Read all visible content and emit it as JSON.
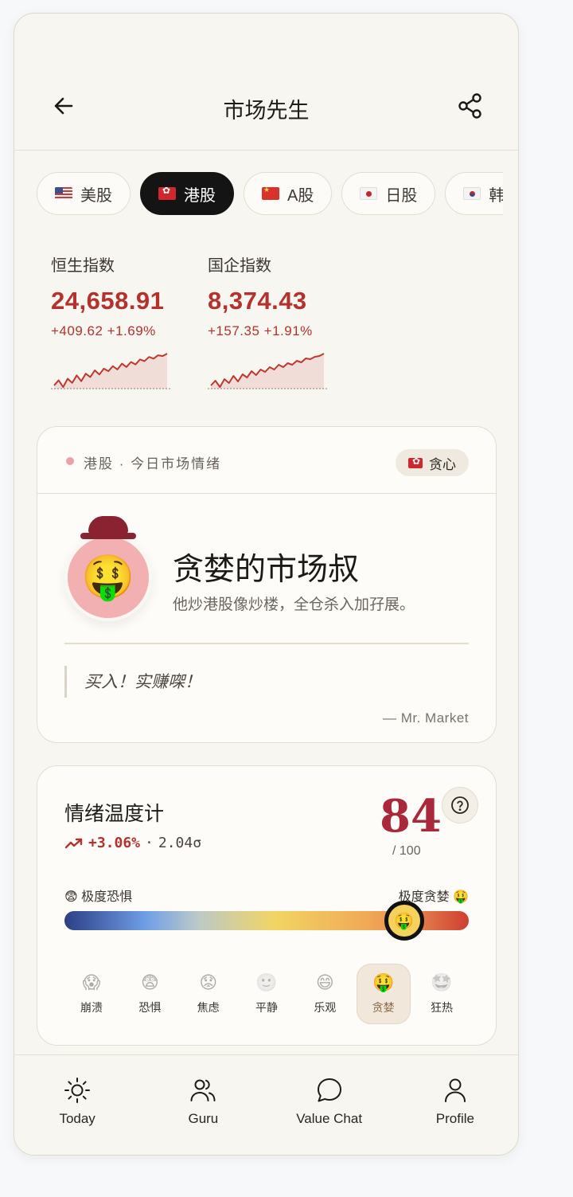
{
  "header": {
    "title": "市场先生",
    "back_icon": "arrow-left-icon",
    "share_icon": "share-icon"
  },
  "market_tabs": [
    {
      "label": "美股",
      "flag": "us-flag-icon",
      "active": false
    },
    {
      "label": "港股",
      "flag": "hk-flag-icon",
      "active": true
    },
    {
      "label": "A股",
      "flag": "cn-flag-icon",
      "active": false
    },
    {
      "label": "日股",
      "flag": "jp-flag-icon",
      "active": false
    },
    {
      "label": "韩",
      "flag": "kr-flag-icon",
      "active": false
    }
  ],
  "indices": [
    {
      "name": "恒生指数",
      "value": "24,658.91",
      "change": "+409.62 +1.69%",
      "trend": [
        8,
        14,
        6,
        16,
        11,
        20,
        13,
        22,
        18,
        26,
        21,
        28,
        25,
        31,
        27,
        34,
        30,
        36,
        33,
        39,
        37,
        42,
        40,
        44,
        43,
        46
      ]
    },
    {
      "name": "国企指数",
      "value": "8,374.43",
      "change": "+157.35 +1.91%",
      "trend": [
        7,
        13,
        5,
        15,
        10,
        19,
        12,
        21,
        17,
        25,
        20,
        27,
        24,
        30,
        27,
        33,
        30,
        35,
        33,
        38,
        36,
        41,
        40,
        43,
        44,
        47
      ]
    }
  ],
  "mood_card": {
    "label": "港股 · 今日市场情绪",
    "badge_label": "贪心",
    "badge_flag": "hk-flag-icon",
    "avatar_emoji": "🤑",
    "title": "贪婪的市场叔",
    "subtitle": "他炒港股像炒楼，全仓杀入加孖展。",
    "quote": "买入！实赚㗎！",
    "quote_author": "— Mr. Market"
  },
  "gauge": {
    "title": "情绪温度计",
    "change_pct": "+3.06%",
    "separator": "·",
    "sigma": "2.04σ",
    "score": "84",
    "score_max": "/ 100",
    "score_fraction": 0.84,
    "scale_left": "😨 极度恐惧",
    "scale_right": "极度贪婪 🤑",
    "knob_emoji": "🤑",
    "levels": [
      {
        "emoji": "😱",
        "label": "崩溃",
        "active": false
      },
      {
        "emoji": "😨",
        "label": "恐惧",
        "active": false
      },
      {
        "emoji": "😟",
        "label": "焦虑",
        "active": false
      },
      {
        "emoji": "🙂",
        "label": "平静",
        "active": false
      },
      {
        "emoji": "😄",
        "label": "乐观",
        "active": false
      },
      {
        "emoji": "🤑",
        "label": "贪婪",
        "active": true
      },
      {
        "emoji": "🤩",
        "label": "狂热",
        "active": false
      }
    ]
  },
  "bottom_nav": [
    {
      "label": "Today",
      "icon": "sun-icon"
    },
    {
      "label": "Guru",
      "icon": "users-icon"
    },
    {
      "label": "Value Chat",
      "icon": "chat-bubble-icon"
    },
    {
      "label": "Profile",
      "icon": "user-icon"
    }
  ],
  "colors": {
    "accent_red": "#b4312d",
    "score_red": "#a9283a",
    "avatar_pink": "#f2b0b2",
    "hat": "#8a2232",
    "background": "#f8f6f1"
  }
}
